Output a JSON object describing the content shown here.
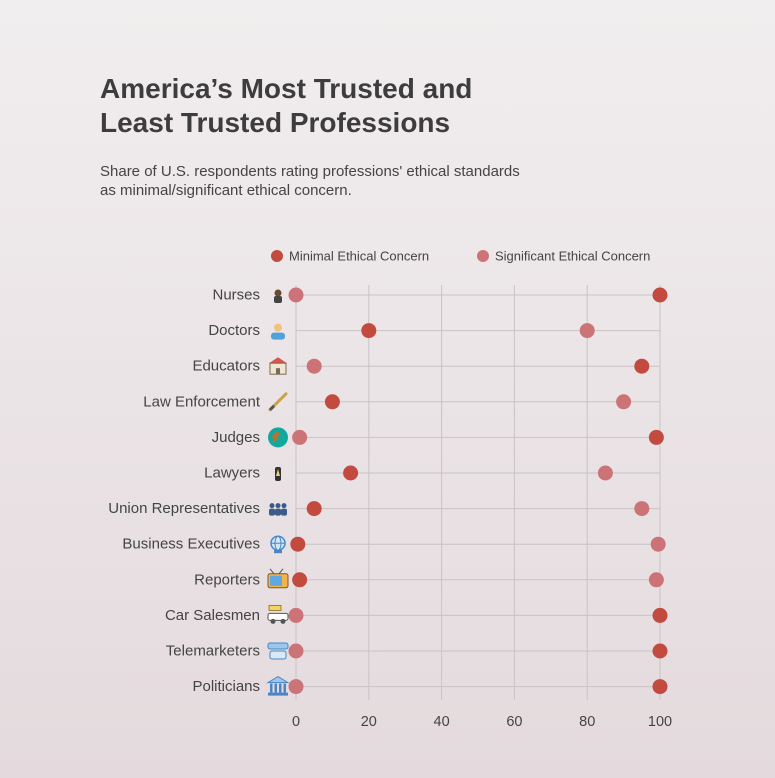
{
  "title": "America’s Most Trusted and Least Trusted Professions",
  "subtitle": "Share of U.S. respondents rating professions' ethical standards as minimal/significant ethical concern.",
  "legend": {
    "placement": "top",
    "items": [
      "Minimal Ethical Concern",
      "Significant Ethical Concern"
    ]
  },
  "colors": {
    "minimal": "#c24a3e",
    "significant": "#cc7378",
    "grid": "#c9c3c5"
  },
  "chart_data": {
    "type": "scatter",
    "subtype": "dumbbell",
    "title": "America’s Most Trusted and Least Trusted Professions",
    "xlabel": "",
    "ylabel": "",
    "xlim": [
      -5,
      100
    ],
    "xticks": [
      0,
      20,
      40,
      60,
      80,
      100
    ],
    "grid": true,
    "categories": [
      "Nurses",
      "Doctors",
      "Educators",
      "Law Enforcement",
      "Judges",
      "Lawyers",
      "Union Representatives",
      "Business Executives",
      "Reporters",
      "Car Salesmen",
      "Telemarketers",
      "Politicians"
    ],
    "category_icons": [
      "nurse-icon",
      "doctor-icon",
      "school-icon",
      "baton-icon",
      "gavel-icon",
      "lawyer-icon",
      "union-icon",
      "globe-icon",
      "tv-icon",
      "car-sale-icon",
      "phone-icon",
      "government-building-icon"
    ],
    "series": [
      {
        "name": "Minimal Ethical Concern",
        "values": [
          100,
          20,
          95,
          10,
          99,
          15,
          5,
          0.5,
          1,
          100,
          100,
          100
        ]
      },
      {
        "name": "Significant Ethical Concern",
        "values": [
          0,
          80,
          5,
          90,
          1,
          85,
          95,
          99.5,
          99,
          0,
          0,
          0
        ]
      }
    ]
  }
}
